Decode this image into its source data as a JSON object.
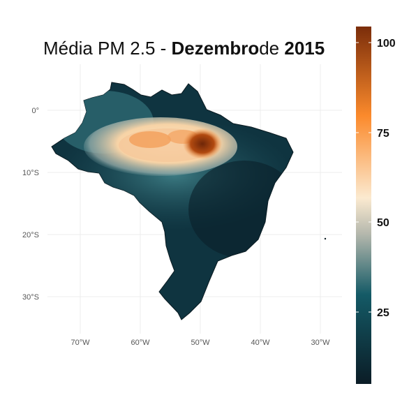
{
  "title": {
    "prefix": "Média PM 2.5 - ",
    "month": "Dezembro",
    "connector": "de ",
    "year": "2015"
  },
  "map": {
    "region": "Brazil",
    "y_ticks": [
      "0°",
      "10°S",
      "20°S",
      "30°S"
    ],
    "x_ticks": [
      "70°W",
      "60°W",
      "50°W",
      "40°W",
      "30°W"
    ],
    "gridlines": true
  },
  "legend": {
    "ticks": [
      "100",
      "75",
      "50",
      "25"
    ],
    "colors": [
      "#0b1c26",
      "#145a66",
      "#b5b8ad",
      "#fbead0",
      "#fb8a2c",
      "#7a2d0a"
    ]
  }
}
